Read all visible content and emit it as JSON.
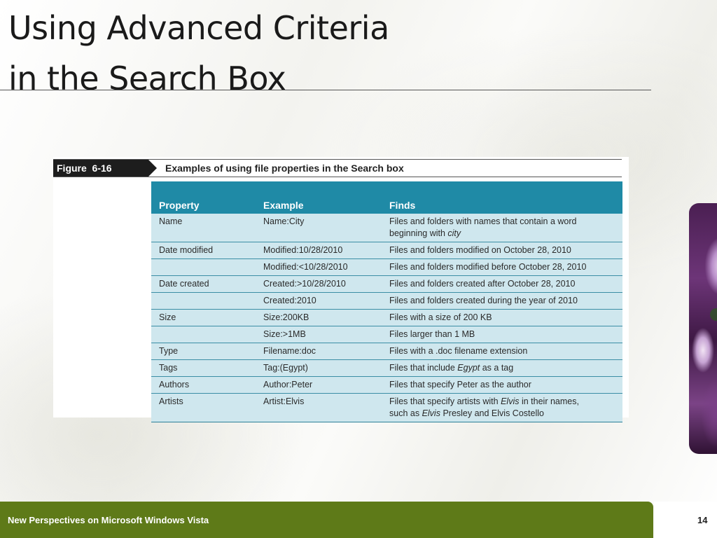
{
  "slide": {
    "title_line1": "Using Advanced Criteria",
    "title_line2": "in the Search Box"
  },
  "figure": {
    "label": "Figure  6-16",
    "caption": "Examples of using file properties in the Search box",
    "columns": [
      "Property",
      "Example",
      "Finds"
    ],
    "rows": [
      {
        "property": "Name",
        "example": "Name:City",
        "finds": [
          "Files and folders with names that contain a word",
          "beginning with city"
        ]
      },
      {
        "property": "Date modified",
        "example": "Modified:10/28/2010",
        "finds": [
          "Files and folders modified on October 28, 2010"
        ]
      },
      {
        "property": "",
        "example": "Modified:<10/28/2010",
        "finds": [
          "Files and folders modified before October 28, 2010"
        ]
      },
      {
        "property": "Date created",
        "example": "Created:>10/28/2010",
        "finds": [
          "Files and folders created after October 28, 2010"
        ]
      },
      {
        "property": "",
        "example": "Created:2010",
        "finds": [
          "Files and folders created during the year of 2010"
        ]
      },
      {
        "property": "Size",
        "example": "Size:200KB",
        "finds": [
          "Files with a size of 200 KB"
        ]
      },
      {
        "property": "",
        "example": "Size:>1MB",
        "finds": [
          "Files larger than 1 MB"
        ]
      },
      {
        "property": "Type",
        "example": "Filename:doc",
        "finds": [
          "Files with a .doc filename extension"
        ]
      },
      {
        "property": "Tags",
        "example": "Tag:(Egypt)",
        "finds": [
          "Files that include Egypt as a tag"
        ]
      },
      {
        "property": "Authors",
        "example": "Author:Peter",
        "finds": [
          "Files that specify Peter as the author"
        ]
      },
      {
        "property": "Artists",
        "example": "Artist:Elvis",
        "finds": [
          "Files that specify artists with Elvis in their names,",
          "such as Elvis Presley and Elvis Costello"
        ]
      }
    ]
  },
  "footer": {
    "text": "New Perspectives on Microsoft Windows Vista",
    "page_number": "14"
  },
  "colors": {
    "table_header": "#1f8aa6",
    "table_body": "#cfe7ee",
    "footer_bar": "#5e7a18"
  },
  "decoration": "flower-image"
}
